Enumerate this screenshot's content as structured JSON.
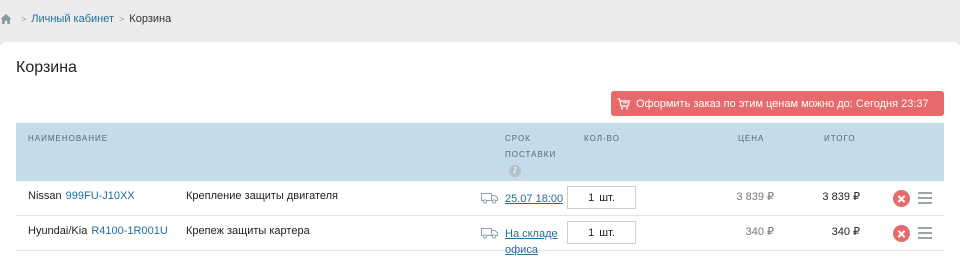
{
  "breadcrumb": {
    "home_icon": "home-icon",
    "separator": ">",
    "link": "Личный кабинет",
    "current": "Корзина"
  },
  "page_title": "Корзина",
  "order_banner": {
    "icon": "cart-icon",
    "text": "Оформить заказ по этим ценам можно до: Сегодня 23:37",
    "color": "#e8696b"
  },
  "table": {
    "headers": {
      "name": "НАИМЕНОВАНИЕ",
      "delivery_line1": "СРОК",
      "delivery_line2": "ПОСТАВКИ",
      "delivery_info": "i",
      "qty": "КОЛ-ВО",
      "price": "ЦЕНА",
      "total": "ИТОГО"
    },
    "header_color": "#c5dbe7",
    "rows": [
      {
        "brand": "Nissan",
        "article": "999FU-J10XX",
        "description": "Крепление защиты двигателя",
        "delivery_line1": "25.07 18:00",
        "delivery_line2": "",
        "qty": "1",
        "unit": "шт.",
        "price": "3 839 ₽",
        "total": "3 839 ₽"
      },
      {
        "brand": "Hyundai/Kia",
        "article": "R4100-1R001U",
        "description": "Крепеж защиты картера",
        "delivery_line1": "На складе",
        "delivery_line2": "офиса",
        "qty": "1",
        "unit": "шт.",
        "price": "340 ₽",
        "total": "340 ₽"
      }
    ]
  },
  "icons": {
    "delivery": "truck-icon",
    "remove": "remove-icon",
    "menu": "menu-icon"
  }
}
